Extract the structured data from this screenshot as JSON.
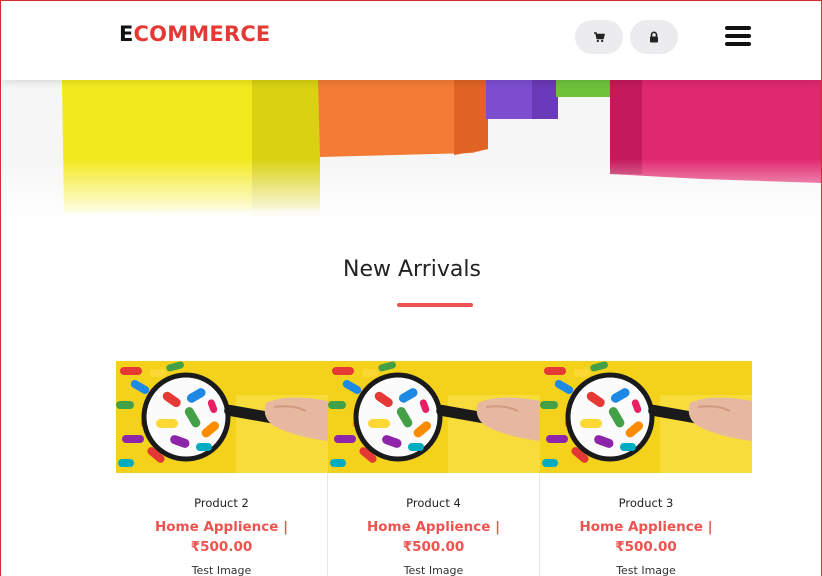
{
  "header": {
    "logo_first_letter": "E",
    "logo_rest": "COMMERCE",
    "cart_icon": "cart-icon",
    "lock_icon": "lock-icon",
    "menu_icon": "hamburger-menu-icon"
  },
  "colors": {
    "accent": "#ef5350",
    "logo_red": "#e53935",
    "icon_button_bg": "#ececef",
    "frame_border": "#d32f2f"
  },
  "section": {
    "title": "New Arrivals"
  },
  "products": [
    {
      "name": "Product 2",
      "category": "Home Applience |",
      "price": "₹500.00",
      "description": "Test Image"
    },
    {
      "name": "Product 4",
      "category": "Home Applience |",
      "price": "₹500.00",
      "description": "Test Image"
    },
    {
      "name": "Product 3",
      "category": "Home Applience |",
      "price": "₹500.00",
      "description": "Test Image"
    }
  ]
}
